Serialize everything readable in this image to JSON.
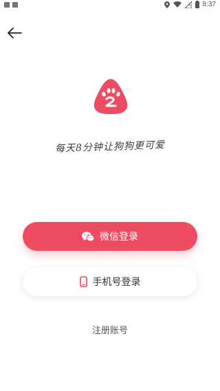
{
  "status_bar": {
    "time": "8:37"
  },
  "slogan": "每天8分钟让狗狗更可爱",
  "buttons": {
    "wechat_login": "微信登录",
    "phone_login": "手机号登录"
  },
  "register_link": "注册账号",
  "colors": {
    "accent": "#ee4c63",
    "background": "#ffffff"
  },
  "icons": {
    "back": "arrow-left-icon",
    "logo": "paw-logo",
    "wechat": "wechat-icon",
    "phone": "phone-icon"
  }
}
